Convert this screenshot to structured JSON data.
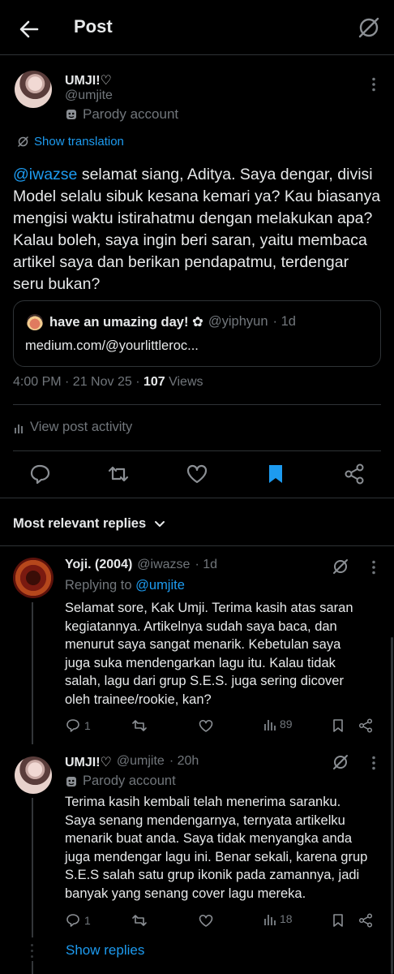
{
  "header": {
    "title": "Post"
  },
  "post": {
    "name": "UMJI!♡",
    "handle": "@umjite",
    "parody": "Parody account",
    "show_translation": "Show translation",
    "mention": "@iwazse",
    "text": " selamat siang, Aditya. Saya dengar, divisi Model selalu sibuk kesana kemari ya? Kau biasanya mengisi waktu istirahatmu dengan melakukan apa? Kalau boleh, saya ingin beri saran, yaitu membaca artikel saya dan berikan pendapatmu, terdengar seru bukan?",
    "quote": {
      "name": "have an umazing day! ✿",
      "handle": "@yiphyun",
      "time": "· 1d",
      "link": "medium.com/@yourlittleroc..."
    },
    "timestamp": "4:00 PM · 21 Nov 25 · ",
    "views_count": "107",
    "views_label": " Views",
    "activity": "View post activity",
    "bookmarked_color": "#1d9bf0"
  },
  "replies_header": "Most relevant replies",
  "replies": [
    {
      "name": "Yoji. (2004)",
      "handle": "@iwazse",
      "time": "· 1d",
      "replying_prefix": "Replying to ",
      "replying_to": "@umjite",
      "text": "Selamat sore, Kak Umji. Terima kasih atas saran kegiatannya. Artikelnya sudah saya baca, dan menurut saya sangat menarik. Kebetulan saya juga suka mendengarkan lagu itu. Kalau tidak salah, lagu dari grup S.E.S. juga sering dicover oleh trainee/rookie, kan?",
      "reply_count": "1",
      "views": "89"
    },
    {
      "name": "UMJI!♡",
      "handle": "@umjite",
      "time": "· 20h",
      "parody": "Parody account",
      "text": "Terima kasih kembali telah menerima saranku. Saya senang mendengarnya, ternyata artikelku menarik buat anda. Saya tidak menyangka anda juga mendengar lagu ini. Benar sekali, karena grup S.E.S salah satu grup ikonik pada zamannya, jadi banyak yang senang cover lagu mereka.",
      "reply_count": "1",
      "views": "18"
    }
  ],
  "show_replies": "Show replies"
}
